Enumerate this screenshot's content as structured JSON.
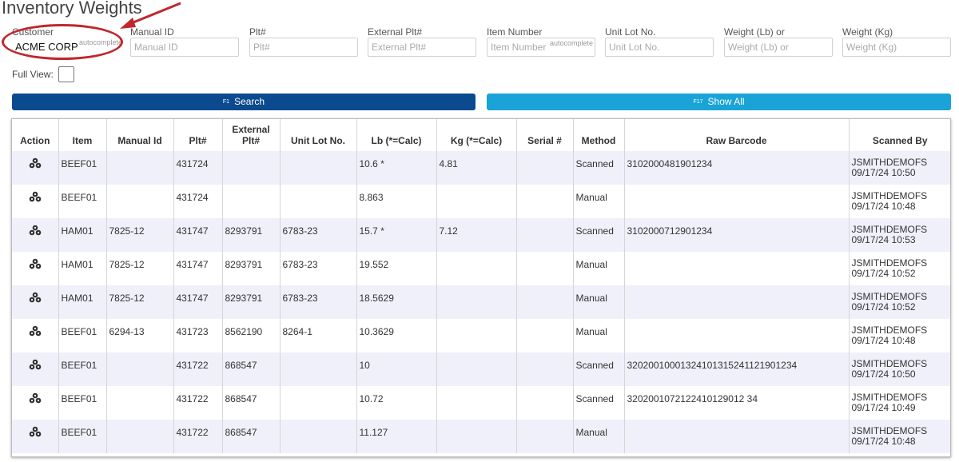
{
  "page": {
    "title": "Inventory Weights"
  },
  "filters": [
    {
      "label": "Customer",
      "value": "ACME CORP",
      "placeholder": "",
      "hint": "autocomplete"
    },
    {
      "label": "Manual ID",
      "value": "",
      "placeholder": "Manual ID",
      "hint": ""
    },
    {
      "label": "Plt#",
      "value": "",
      "placeholder": "Plt#",
      "hint": ""
    },
    {
      "label": "External Plt#",
      "value": "",
      "placeholder": "External Plt#",
      "hint": ""
    },
    {
      "label": "Item Number",
      "value": "",
      "placeholder": "Item Number",
      "hint": "autocomplete"
    },
    {
      "label": "Unit Lot No.",
      "value": "",
      "placeholder": "Unit Lot No.",
      "hint": ""
    },
    {
      "label": "Weight (Lb) or",
      "value": "",
      "placeholder": "Weight (Lb) or",
      "hint": ""
    },
    {
      "label": "Weight (Kg)",
      "value": "",
      "placeholder": "Weight (Kg)",
      "hint": ""
    }
  ],
  "full_view": {
    "label": "Full View:",
    "checked": false
  },
  "buttons": {
    "search": {
      "key": "F1",
      "label": "Search"
    },
    "show_all": {
      "key": "F17",
      "label": "Show All"
    }
  },
  "annotation": {
    "color": "#c0262b"
  },
  "colors": {
    "primary": "#0b4a8f",
    "secondary": "#1aa3d6",
    "row_alt": "#eff0fa"
  },
  "table": {
    "headers": [
      "Action",
      "Item",
      "Manual Id",
      "Plt#",
      "External Plt#",
      "Unit Lot No.",
      "Lb (*=Calc)",
      "Kg (*=Calc)",
      "Serial #",
      "Method",
      "Raw Barcode",
      "Scanned By"
    ],
    "action_icon": "action-menu-icon",
    "rows": [
      {
        "item": "BEEF01",
        "manual_id": "",
        "plt": "431724",
        "ext_plt": "",
        "lot": "",
        "lb": "10.6 *",
        "kg": "4.81",
        "serial": "",
        "method": "Scanned",
        "barcode": "3102000481901234",
        "user": "JSMITHDEMOFS",
        "date": "09/17/24 10:50"
      },
      {
        "item": "BEEF01",
        "manual_id": "",
        "plt": "431724",
        "ext_plt": "",
        "lot": "",
        "lb": "8.863",
        "kg": "",
        "serial": "",
        "method": "Manual",
        "barcode": "",
        "user": "JSMITHDEMOFS",
        "date": "09/17/24 10:48"
      },
      {
        "item": "HAM01",
        "manual_id": "7825-12",
        "plt": "431747",
        "ext_plt": "8293791",
        "lot": "6783-23",
        "lb": "15.7 *",
        "kg": "7.12",
        "serial": "",
        "method": "Scanned",
        "barcode": "3102000712901234",
        "user": "JSMITHDEMOFS",
        "date": "09/17/24 10:53"
      },
      {
        "item": "HAM01",
        "manual_id": "7825-12",
        "plt": "431747",
        "ext_plt": "8293791",
        "lot": "6783-23",
        "lb": "19.552",
        "kg": "",
        "serial": "",
        "method": "Manual",
        "barcode": "",
        "user": "JSMITHDEMOFS",
        "date": "09/17/24 10:52"
      },
      {
        "item": "HAM01",
        "manual_id": "7825-12",
        "plt": "431747",
        "ext_plt": "8293791",
        "lot": "6783-23",
        "lb": "18.5629",
        "kg": "",
        "serial": "",
        "method": "Manual",
        "barcode": "",
        "user": "JSMITHDEMOFS",
        "date": "09/17/24 10:52"
      },
      {
        "item": "BEEF01",
        "manual_id": "6294-13",
        "plt": "431723",
        "ext_plt": "8562190",
        "lot": "8264-1",
        "lb": "10.3629",
        "kg": "",
        "serial": "",
        "method": "Manual",
        "barcode": "",
        "user": "JSMITHDEMOFS",
        "date": "09/17/24 10:48"
      },
      {
        "item": "BEEF01",
        "manual_id": "",
        "plt": "431722",
        "ext_plt": "868547",
        "lot": "",
        "lb": "10",
        "kg": "",
        "serial": "",
        "method": "Scanned",
        "barcode": "320200100013241013152411219012­34",
        "user": "JSMITHDEMOFS",
        "date": "09/17/24 10:50"
      },
      {
        "item": "BEEF01",
        "manual_id": "",
        "plt": "431722",
        "ext_plt": "868547",
        "lot": "",
        "lb": "10.72",
        "kg": "",
        "serial": "",
        "method": "Scanned",
        "barcode": "3202001072122410129012 34",
        "user": "JSMITHDEMOFS",
        "date": "09/17/24 10:49"
      },
      {
        "item": "BEEF01",
        "manual_id": "",
        "plt": "431722",
        "ext_plt": "868547",
        "lot": "",
        "lb": "11.127",
        "kg": "",
        "serial": "",
        "method": "Manual",
        "barcode": "",
        "user": "JSMITHDEMOFS",
        "date": "09/17/24 10:48"
      }
    ]
  }
}
